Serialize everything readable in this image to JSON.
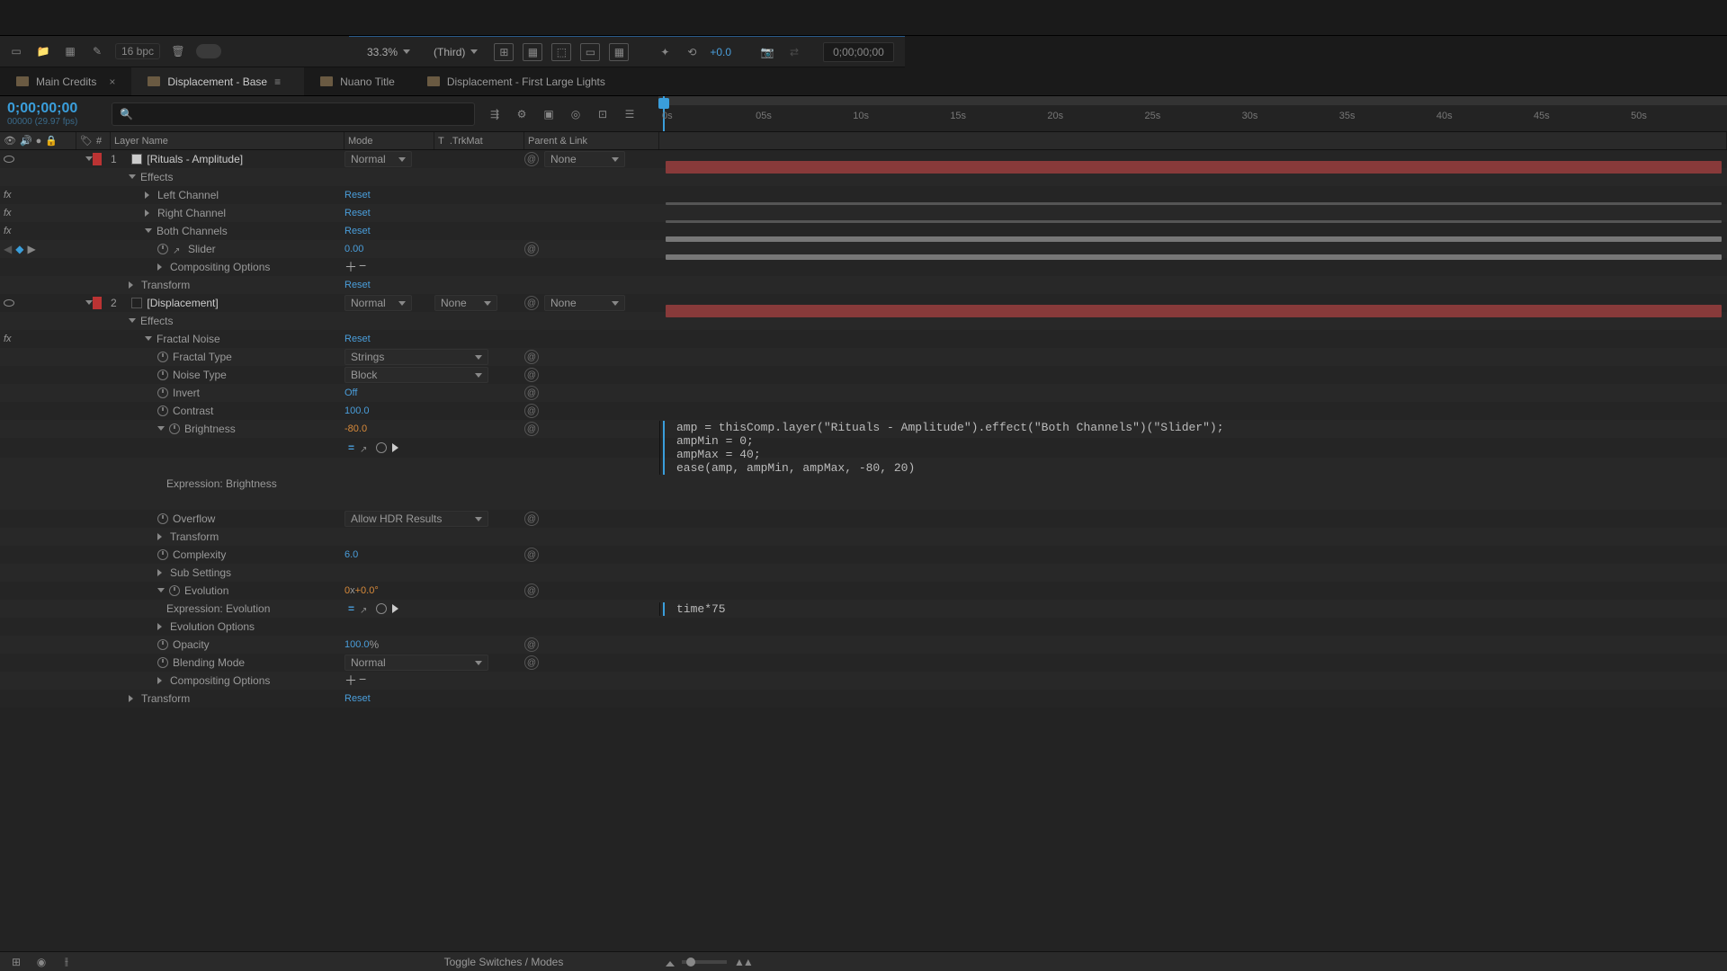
{
  "toolbar": {
    "bpc": "16 bpc"
  },
  "viewer": {
    "zoom": "33.3%",
    "quality": "(Third)",
    "exposure": "+0.0",
    "timecode_box": "0;00;00;00"
  },
  "tabs": {
    "t0": "Main Credits",
    "t1": "Displacement - Base",
    "t2": "Nuano Title",
    "t3": "Displacement - First Large Lights"
  },
  "timecode": {
    "big": "0;00;00;00",
    "small": "00000 (29.97 fps)"
  },
  "ruler": [
    "0s",
    "05s",
    "10s",
    "15s",
    "20s",
    "25s",
    "30s",
    "35s",
    "40s",
    "45s",
    "50s"
  ],
  "cols": {
    "layerName": "Layer Name",
    "mode": "Mode",
    "t": "T",
    "trkmat": ".TrkMat",
    "parent": "Parent & Link",
    "numsym": "#"
  },
  "mode_normal": "Normal",
  "none": "None",
  "reset": "Reset",
  "layer1": {
    "num": "1",
    "name": "[Rituals - Amplitude]",
    "effects": "Effects",
    "left": "Left Channel",
    "right": "Right Channel",
    "both": "Both Channels",
    "slider": "Slider",
    "sliderVal": "0.00",
    "comp": "Compositing Options",
    "transform": "Transform"
  },
  "layer2": {
    "num": "2",
    "name": "[Displacement]",
    "effects": "Effects",
    "fractal": "Fractal Noise",
    "fractalType": "Fractal Type",
    "fractalTypeVal": "Strings",
    "noiseType": "Noise Type",
    "noiseTypeVal": "Block",
    "invert": "Invert",
    "invertVal": "Off",
    "contrast": "Contrast",
    "contrastVal": "100.0",
    "brightness": "Brightness",
    "brightnessVal": "-80.0",
    "exprBrightness": "Expression: Brightness",
    "exprBrightCode": "amp = thisComp.layer(\"Rituals - Amplitude\").effect(\"Both Channels\")(\"Slider\");\nampMin = 0;\nampMax = 40;\nease(amp, ampMin, ampMax, -80, 20)",
    "overflow": "Overflow",
    "overflowVal": "Allow HDR Results",
    "transform": "Transform",
    "complexity": "Complexity",
    "complexityVal": "6.0",
    "sub": "Sub Settings",
    "evolution": "Evolution",
    "evolutionPre": "0",
    "evolutionX": "x",
    "evolutionVal": "+0.0",
    "evolutionDeg": "°",
    "exprEvolution": "Expression: Evolution",
    "exprEvoCode": "time*75",
    "evoOptions": "Evolution Options",
    "opacity": "Opacity",
    "opacityVal": "100.0",
    "opacityPct": "%",
    "blend": "Blending Mode",
    "blendVal": "Normal",
    "comp": "Compositing Options",
    "transform2": "Transform"
  },
  "footer": {
    "toggle": "Toggle Switches / Modes"
  }
}
